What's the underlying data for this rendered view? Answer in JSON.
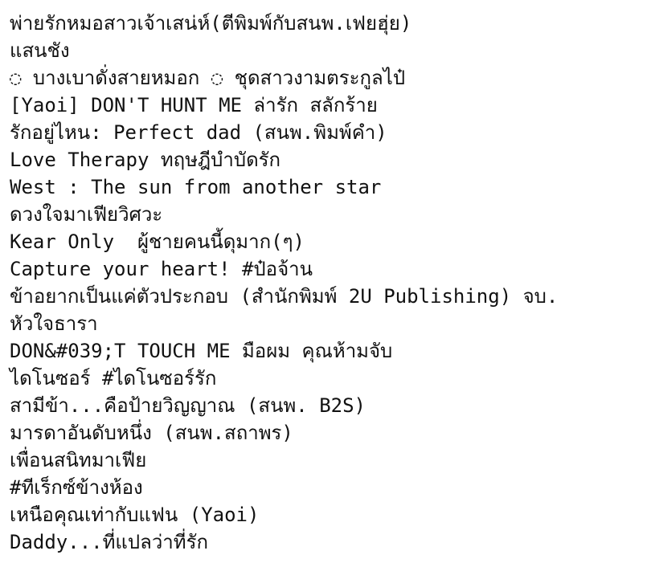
{
  "document": {
    "lines": [
      "พ่ายรักหมอสาวเจ้าเสน่ห์(ตีพิมพ์กับสนพ.เฟยฮุ่ย)",
      "แสนชัง",
      "◌ บางเบาดั่งสายหมอก ◌ ชุดสาวงามตระกูลไป๋",
      "[Yaoi] DON'T HUNT ME ล่ารัก สลักร้าย",
      "รักอยู่ไหน: Perfect dad (สนพ.พิมพ์คำ)",
      "Love Therapy ทฤษฎีบำบัดรัก",
      "West : The sun from another star",
      "ดวงใจมาเฟียวิศวะ",
      "Kear Only  ผู้ชายคนนี้ดุมาก(ๆ)",
      "Capture your heart! #ป๋อจ้าน",
      "ข้าอยากเป็นแค่ตัวประกอบ (สำนักพิมพ์ 2U Publishing) จบ.",
      "หัวใจธารา",
      "DON&#039;T TOUCH ME มือผม คุณห้ามจับ",
      "ไดโนซอร์ #ไดโนซอร์รัก",
      "สามีข้า...คือป้ายวิญญาณ (สนพ. B2S)",
      "มารดาอันดับหนึ่ง (สนพ.สถาพร)",
      "เพื่อนสนิทมาเฟีย",
      "#ทีเร็กซ์ข้างห้อง",
      "เหนือคุณเท่ากับแฟน (Yaoi)",
      "Daddy...ที่แปลว่าที่รัก"
    ]
  }
}
